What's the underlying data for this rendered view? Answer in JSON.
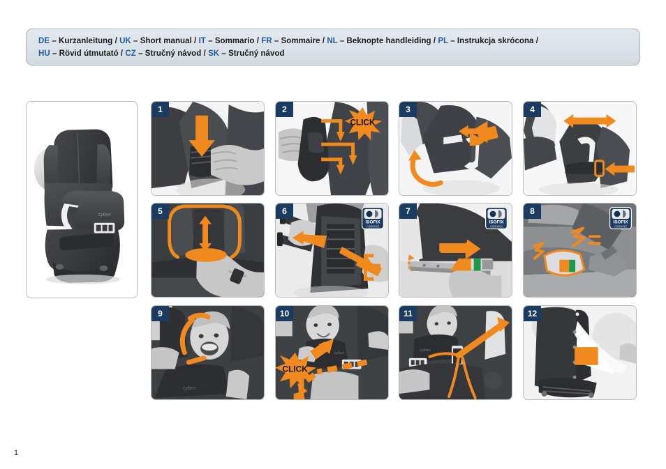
{
  "document": {
    "page_number": "1"
  },
  "header": {
    "line1": [
      {
        "code": "DE",
        "dash": " – ",
        "text": "Kurzanleitung",
        "sep": " / "
      },
      {
        "code": "UK",
        "dash": " – ",
        "text": "Short manual",
        "sep": " / "
      },
      {
        "code": "IT",
        "dash": " – ",
        "text": "Sommario",
        "sep": " / "
      },
      {
        "code": "FR",
        "dash": " – ",
        "text": "Sommaire",
        "sep": " / "
      },
      {
        "code": "NL",
        "dash": " – ",
        "text": "Beknopte handleiding",
        "sep": " / "
      },
      {
        "code": "PL",
        "dash": " – ",
        "text": "Instrukcja skrócona",
        "sep": " /"
      }
    ],
    "line2": [
      {
        "code": "HU",
        "dash": " – ",
        "text": "Rövid útmutató",
        "sep": " / "
      },
      {
        "code": "CZ",
        "dash": " – ",
        "text": "Stručný návod",
        "sep": " / "
      },
      {
        "code": "SK",
        "dash": " – ",
        "text": "Stručný návod",
        "sep": ""
      }
    ],
    "accent_color": "#1f5c9e",
    "text_color": "#1a1a1a",
    "background_color": "#dde3ea",
    "border_color": "#a9b0b7"
  },
  "colors": {
    "orange": "#f08a1e",
    "orange_dark": "#e07d12",
    "badge_navy": "#1b3c60",
    "panel_border": "#b9bdc1",
    "green": "#1c9a4a",
    "photo_dark": "#3a3c3e",
    "photo_mid": "#6d7073",
    "photo_light": "#d6d7d8"
  },
  "product": {
    "name": "child-car-seat",
    "brand_mark": "cybex",
    "panel_label": "product-photo"
  },
  "isofix_logo": {
    "title": "ISOFIX",
    "subtitle": "connect",
    "background": "#1b3c60",
    "appears_in_steps": [
      "6",
      "7",
      "8"
    ]
  },
  "steps": [
    {
      "number": "1",
      "name": "step-1-press-headrest-release",
      "annotations": [
        "orange-down-arrow"
      ],
      "click_label": null
    },
    {
      "number": "2",
      "name": "step-2-attach-backrest",
      "annotations": [
        "orange-bracket-arrows",
        "click-burst"
      ],
      "click_label": "CLICK"
    },
    {
      "number": "3",
      "name": "step-3-rotate-and-slide",
      "annotations": [
        "orange-left-arrow",
        "orange-curved-arrow"
      ],
      "click_label": null
    },
    {
      "number": "4",
      "name": "step-4-adjust-side-protector",
      "annotations": [
        "orange-double-arrow",
        "orange-left-arrow",
        "orange-outline-rect"
      ],
      "click_label": null
    },
    {
      "number": "5",
      "name": "step-5-adjust-headrest-height",
      "annotations": [
        "orange-outline-headrest",
        "orange-vertical-double-arrow",
        "orange-ellipse"
      ],
      "click_label": null
    },
    {
      "number": "6",
      "name": "step-6-extend-isofix-connectors",
      "annotations": [
        "orange-left-arrow",
        "orange-right-arrow",
        "orange-bracket"
      ],
      "click_label": null,
      "badge": "ISOFIX"
    },
    {
      "number": "7",
      "name": "step-7-insert-isofix-guides",
      "annotations": [
        "orange-right-arrow",
        "orange-triangle",
        "green-indicator",
        "orange-dashed-curve"
      ],
      "click_label": null,
      "badge": "ISOFIX"
    },
    {
      "number": "8",
      "name": "step-8-check-indicator-green",
      "annotations": [
        "orange-outline-connector",
        "orange-zigzag-marks",
        "green-indicator",
        "orange-indicator"
      ],
      "click_label": null,
      "badge": "ISOFIX"
    },
    {
      "number": "9",
      "name": "step-9-seat-child",
      "annotations": [
        "orange-arc",
        "orange-line"
      ],
      "click_label": null
    },
    {
      "number": "10",
      "name": "step-10-fasten-buckle",
      "annotations": [
        "click-burst",
        "orange-dashed-arrows"
      ],
      "click_label": "CLICK"
    },
    {
      "number": "11",
      "name": "step-11-route-shoulder-belt",
      "annotations": [
        "orange-belt-path-lines",
        "orange-diagonal-arrow"
      ],
      "click_label": null
    },
    {
      "number": "12",
      "name": "step-12-attach-seat-cover",
      "annotations": [
        "orange-filled-rect"
      ],
      "click_label": null
    }
  ]
}
